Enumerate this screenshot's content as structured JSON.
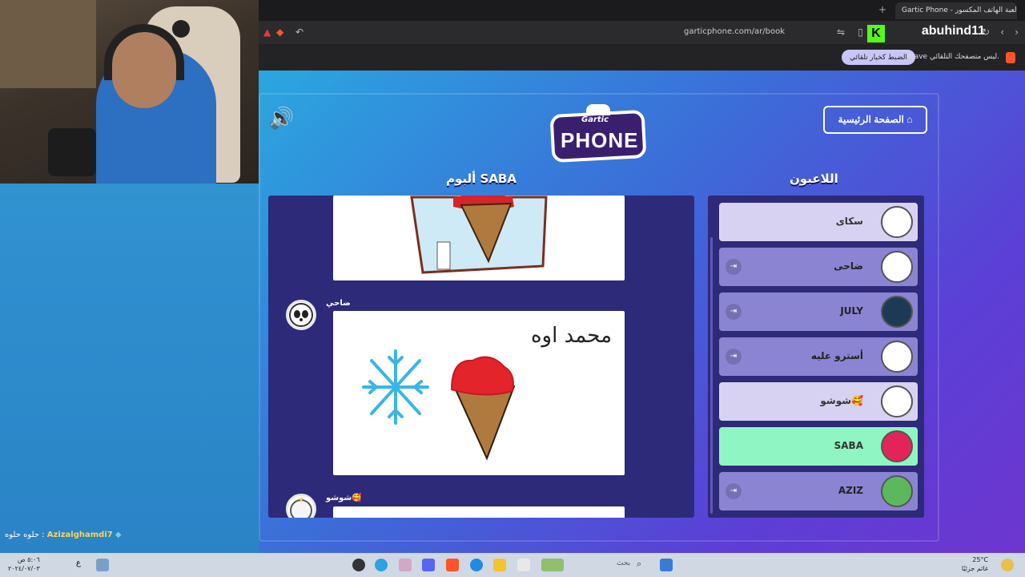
{
  "browser": {
    "tab_title": "Gartic Phone - لعبة الهاتف المكسور",
    "tab_close": "✕",
    "tab_new": "+",
    "url": "garticphone.com/ar/book",
    "brand": "abuhind11",
    "kick_logo": "K",
    "notice_text": "Brave ليس متصفحك التلقائي.",
    "notice_button": "الضبط كخيار تلقائي"
  },
  "game": {
    "home_button": "الصفحة الرئيسية",
    "logo_small": "Gartic",
    "logo_big": "PHONE",
    "album_title": "ألبوم SABA",
    "players_title": "اللاعبون",
    "entries": [
      {
        "author": "ضاحي",
        "caption": "محمد اوه"
      },
      {
        "author": "شوشو🥰"
      }
    ],
    "players": [
      {
        "name": "سكاى"
      },
      {
        "name": "ضاحى"
      },
      {
        "name": "JULY"
      },
      {
        "name": "أسترو عليه"
      },
      {
        "name": "شوشو🥰"
      },
      {
        "name": "SABA"
      },
      {
        "name": "AZIZ"
      }
    ]
  },
  "stream": {
    "chat_user": "Azizalghamdi7",
    "chat_message": "حلوه حلوه :"
  },
  "taskbar": {
    "time": "٥:٠٦ ص",
    "date": "٢٠٢٤/٠٧/٠٣",
    "weather_temp": "25°C",
    "weather_text": "غائم جزئيًا",
    "search_label": "بحث",
    "lang": "ع"
  }
}
